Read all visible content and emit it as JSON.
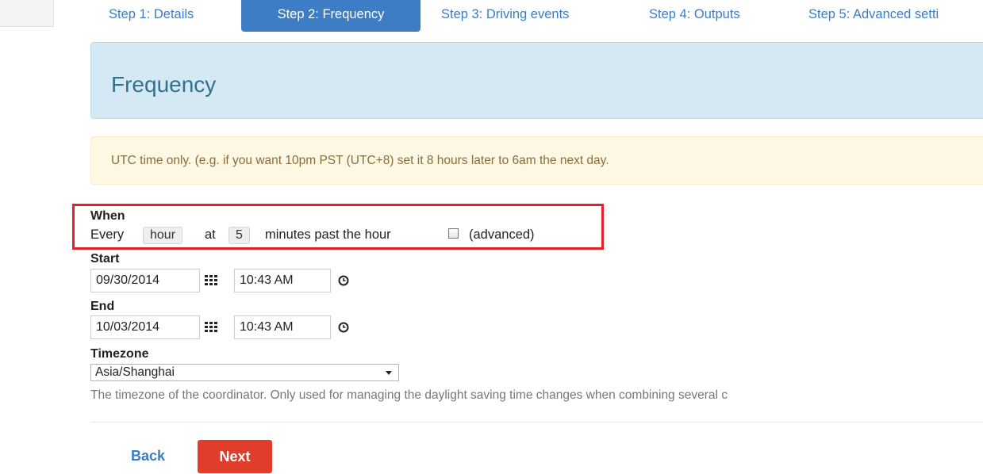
{
  "tabs": [
    {
      "label": "Step 1: Details"
    },
    {
      "label": "Step 2: Frequency"
    },
    {
      "label": "Step 3: Driving events"
    },
    {
      "label": "Step 4: Outputs"
    },
    {
      "label": "Step 5: Advanced setti"
    }
  ],
  "header": {
    "title": "Frequency"
  },
  "alert": {
    "text": "UTC time only. (e.g. if you want 10pm PST (UTC+8) set it 8 hours later to 6am the next day."
  },
  "when": {
    "label": "When",
    "every": "Every",
    "unit": "hour",
    "at": "at",
    "minutes": "5",
    "suffix": "minutes past the hour",
    "advanced_label": "(advanced)",
    "advanced_checked": false
  },
  "start": {
    "label": "Start",
    "date": "09/30/2014",
    "time": "10:43 AM"
  },
  "end": {
    "label": "End",
    "date": "10/03/2014",
    "time": "10:43 AM"
  },
  "timezone": {
    "label": "Timezone",
    "value": "Asia/Shanghai",
    "help": "The timezone of the coordinator. Only used for managing the daylight saving time changes when combining several c"
  },
  "actions": {
    "back": "Back",
    "next": "Next"
  },
  "colors": {
    "primary": "#3c7dc6",
    "danger": "#e03d2a",
    "info_bg": "#d5e9f4",
    "warning_bg": "#fcf8e3",
    "highlight": "#e3202b"
  }
}
